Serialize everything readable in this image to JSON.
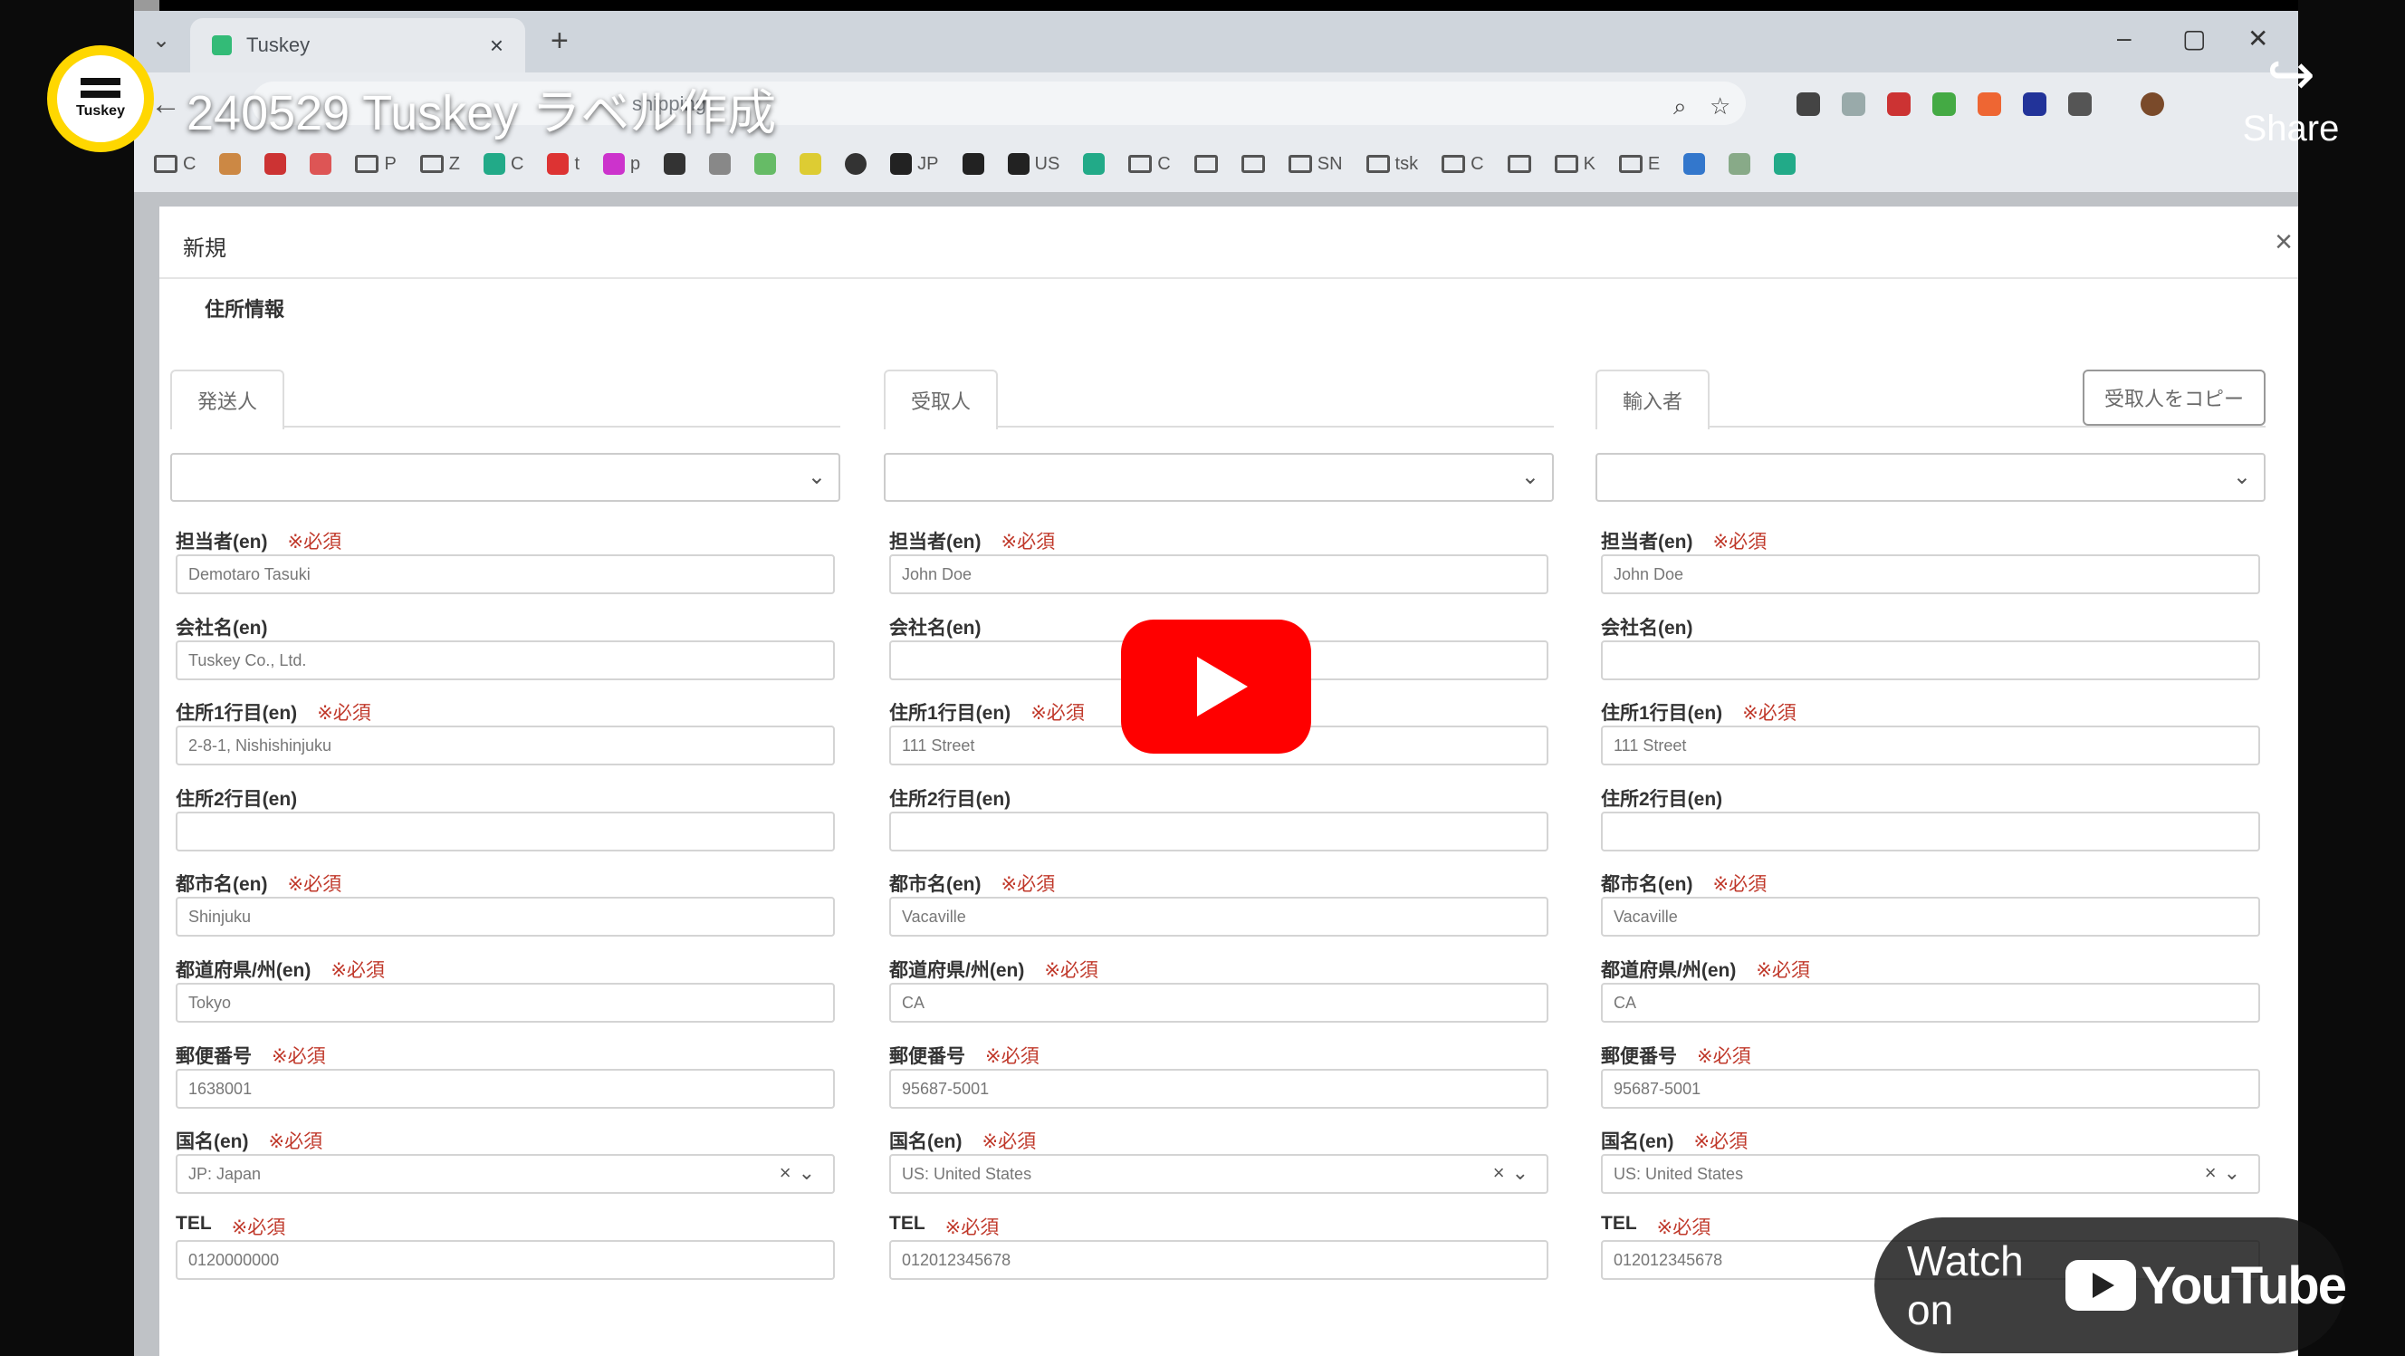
{
  "video": {
    "title": "240529 Tuskey ラベル作成",
    "channel_name": "Tuskey",
    "share_label": "Share",
    "watch_on_label": "Watch on",
    "youtube_label": "YouTube"
  },
  "browser": {
    "tab_title": "Tuskey",
    "address_partial": "shipping",
    "bookmarks": [
      "C",
      "",
      "",
      "",
      "P",
      "Z",
      "C",
      "t",
      "p",
      "",
      "",
      "",
      "",
      "",
      "JP",
      "",
      "US",
      "",
      "C",
      "",
      "",
      "SN",
      "tsk",
      "C",
      "",
      "K",
      "E",
      "",
      "",
      ""
    ]
  },
  "modal": {
    "title": "新規",
    "section_title": "住所情報",
    "copy_button": "受取人をコピー",
    "required_label": "※必須",
    "labels": {
      "contact": "担当者(en)",
      "company": "会社名(en)",
      "address1": "住所1行目(en)",
      "address2": "住所2行目(en)",
      "city": "都市名(en)",
      "state": "都道府県/州(en)",
      "postal": "郵便番号",
      "country": "国名(en)",
      "tel": "TEL"
    },
    "columns": [
      {
        "tab": "発送人",
        "contact": "Demotaro Tasuki",
        "company": "Tuskey Co., Ltd.",
        "address1": "2-8-1, Nishishinjuku",
        "address2": "",
        "city": "Shinjuku",
        "state": "Tokyo",
        "postal": "1638001",
        "country": "JP: Japan",
        "tel": "0120000000"
      },
      {
        "tab": "受取人",
        "contact": "John Doe",
        "company": "",
        "address1": "111 Street",
        "address2": "",
        "city": "Vacaville",
        "state": "CA",
        "postal": "95687-5001",
        "country": "US: United States",
        "tel": "012012345678"
      },
      {
        "tab": "輸入者",
        "contact": "John Doe",
        "company": "",
        "address1": "111 Street",
        "address2": "",
        "city": "Vacaville",
        "state": "CA",
        "postal": "95687-5001",
        "country": "US: United States",
        "tel": "012012345678"
      }
    ]
  },
  "colors": {
    "required": "#c0392b",
    "play_button": "#ff0000",
    "channel_ring": "#ffd700"
  }
}
